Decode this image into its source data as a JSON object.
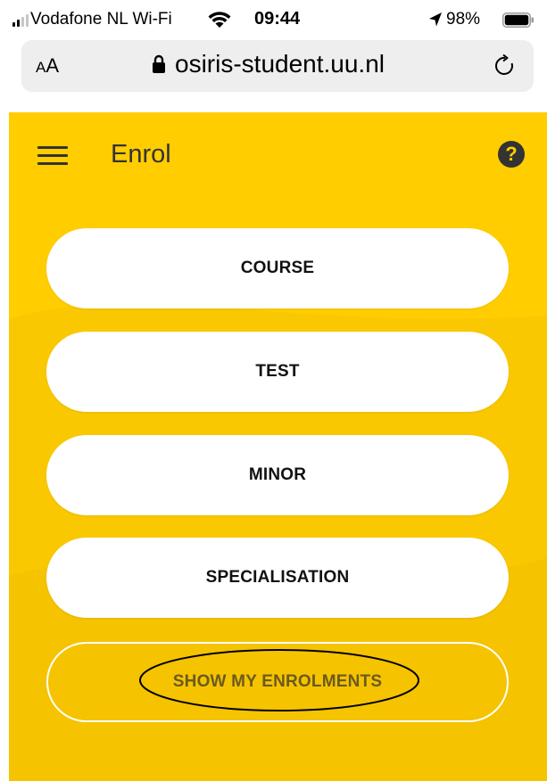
{
  "status_bar": {
    "carrier": "Vodafone NL Wi-Fi",
    "time": "09:44",
    "battery_percent": "98%",
    "icons": [
      "signal-icon",
      "wifi-icon",
      "location-arrow-icon",
      "battery-icon"
    ]
  },
  "address_bar": {
    "text_size_button": "AA",
    "url": "osiris-student.uu.nl",
    "icons": [
      "lock-icon",
      "reload-icon"
    ]
  },
  "header": {
    "title": "Enrol",
    "icons": [
      "hamburger-menu-icon",
      "help-icon"
    ]
  },
  "buttons": [
    {
      "label": "COURSE"
    },
    {
      "label": "TEST"
    },
    {
      "label": "MINOR"
    },
    {
      "label": "SPECIALISATION"
    }
  ],
  "show_enrolments": {
    "label": "SHOW MY ENROLMENTS"
  },
  "colors": {
    "accent_yellow": "#ffcd00",
    "button_white": "#ffffff",
    "header_text": "#333333",
    "outline_label": "#6b5a1e"
  }
}
